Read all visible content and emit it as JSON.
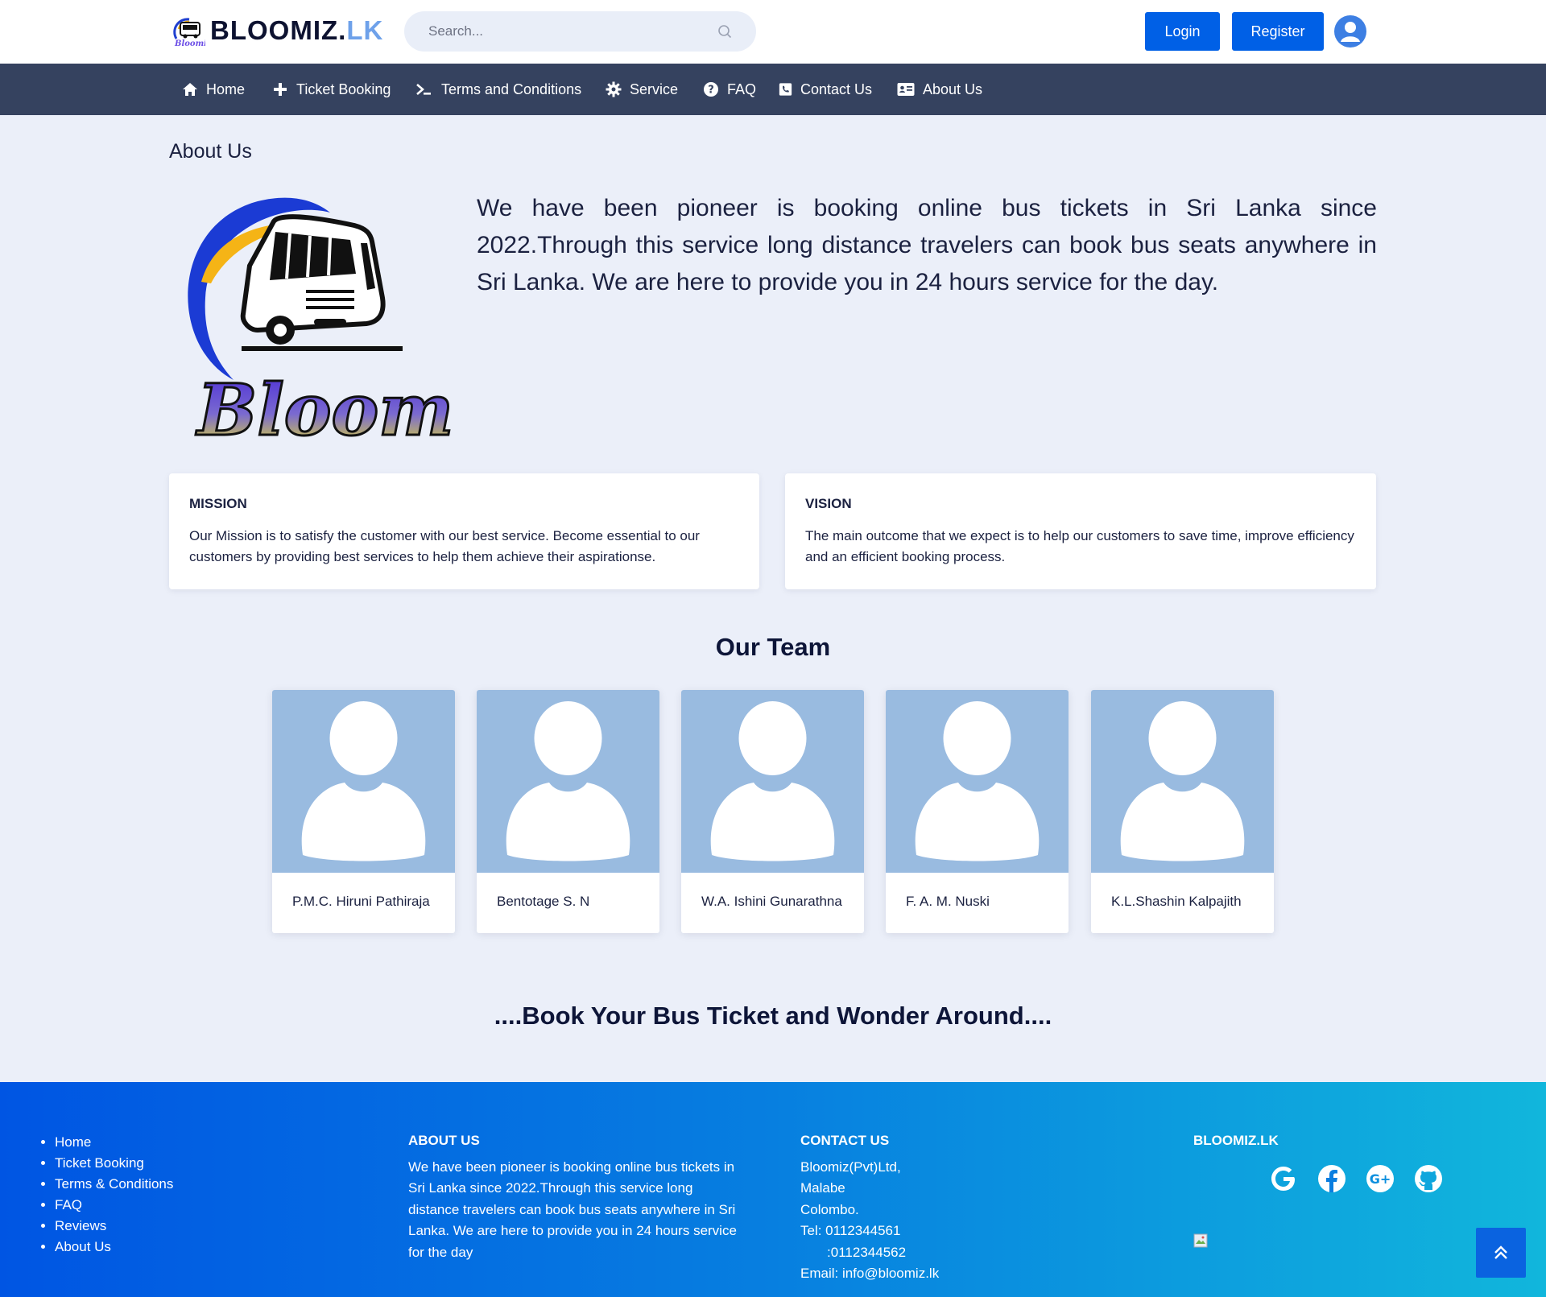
{
  "header": {
    "brand_main": "BLOOMIZ.",
    "brand_accent": "LK",
    "search_placeholder": "Search...",
    "login_label": "Login",
    "register_label": "Register",
    "icons": {
      "search": "search-icon",
      "user": "user-circle-icon"
    }
  },
  "nav": {
    "items": [
      {
        "label": "Home",
        "icon": "home-icon"
      },
      {
        "label": "Ticket Booking",
        "icon": "plus-icon"
      },
      {
        "label": "Terms and Conditions",
        "icon": "terminal-icon"
      },
      {
        "label": "Service",
        "icon": "gear-icon"
      },
      {
        "label": "FAQ",
        "icon": "question-circle-icon"
      },
      {
        "label": "Contact Us",
        "icon": "phone-square-icon"
      },
      {
        "label": "About Us",
        "icon": "id-card-icon"
      }
    ]
  },
  "about": {
    "title": "About Us",
    "logo_text": "Bloomiz",
    "intro": "We have been pioneer is booking online bus tickets in Sri Lanka since 2022.Through this service long distance travelers can book bus seats anywhere in Sri Lanka. We are here to provide you in 24 hours service for the day.",
    "mission": {
      "heading": "MISSION",
      "text": "Our Mission is to satisfy the customer with our best service. Become essential to our customers by providing best services to help them achieve their aspirationse."
    },
    "vision": {
      "heading": "VISION",
      "text": "The main outcome that we expect is to help our customers to save time, improve efficiency and an efficient booking process."
    }
  },
  "team": {
    "title": "Our Team",
    "members": [
      {
        "name": "P.M.C. Hiruni Pathiraja"
      },
      {
        "name": "Bentotage S. N"
      },
      {
        "name": "W.A. Ishini Gunarathna"
      },
      {
        "name": "F. A. M. Nuski"
      },
      {
        "name": "K.L.Shashin Kalpajith"
      }
    ]
  },
  "slogan": "....Book Your Bus Ticket and Wonder Around....",
  "footer": {
    "links": [
      "Home",
      "Ticket Booking",
      "Terms & Conditions",
      "FAQ",
      "Reviews",
      "About Us"
    ],
    "about_heading": "ABOUT US",
    "about_text": "We have been pioneer is booking online bus tickets in Sri Lanka since 2022.Through this service long distance travelers can book bus seats anywhere in Sri Lanka. We are here to provide you in 24 hours service for the day",
    "contact_heading": "CONTACT US",
    "contact_lines": [
      "Bloomiz(Pvt)Ltd,",
      "Malabe",
      "Colombo.",
      "Tel: 0112344561",
      "       :0112344562",
      "Email: info@bloomiz.lk"
    ],
    "brand_heading": "BLOOMIZ.LK",
    "socials": [
      "google-icon",
      "facebook-icon",
      "google-plus-icon",
      "github-icon"
    ]
  },
  "colors": {
    "primary": "#0060e6",
    "nav_bg": "#35425f",
    "page_bg": "#ebeff9",
    "footer_start": "#0055e3",
    "footer_end": "#11b6dc"
  }
}
